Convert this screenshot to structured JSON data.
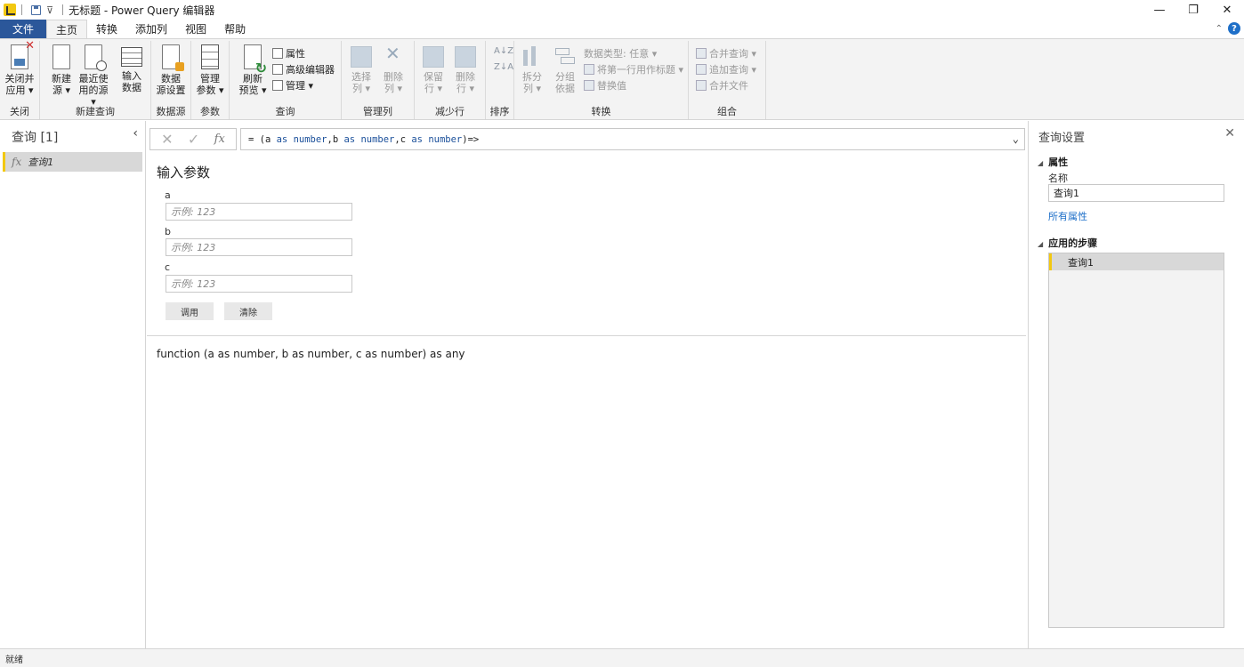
{
  "titlebar": {
    "title": "无标题 - Power Query 编辑器",
    "qa_dropdown": "⊽",
    "window_buttons": {
      "minimize": "—",
      "restore": "❐",
      "close": "✕"
    }
  },
  "menu": {
    "tabs": [
      {
        "label": "文件"
      },
      {
        "label": "主页"
      },
      {
        "label": "转换"
      },
      {
        "label": "添加列"
      },
      {
        "label": "视图"
      },
      {
        "label": "帮助"
      }
    ],
    "collapse": "⌃",
    "help": "?"
  },
  "ribbon": {
    "close": {
      "group_label": "关闭",
      "close_apply": "关闭并\n应用 ▾"
    },
    "new_query": {
      "group_label": "新建查询",
      "new_source": "新建\n源 ▾",
      "recent_sources": "最近使\n用的源 ▾",
      "enter_data": "输入\n数据"
    },
    "data_sources": {
      "group_label": "数据源",
      "settings": "数据\n源设置"
    },
    "parameters": {
      "group_label": "参数",
      "manage": "管理\n参数 ▾"
    },
    "query": {
      "group_label": "查询",
      "refresh_preview": "刷新\n预览 ▾",
      "properties": "属性",
      "advanced_editor": "高级编辑器",
      "manage": "管理 ▾"
    },
    "manage_columns": {
      "group_label": "管理列",
      "choose_columns": "选择\n列 ▾",
      "remove_columns": "删除\n列 ▾"
    },
    "reduce_rows": {
      "group_label": "减少行",
      "keep_rows": "保留\n行 ▾",
      "remove_rows": "删除\n行 ▾"
    },
    "sort": {
      "group_label": "排序",
      "asc": "A↓Z",
      "desc": "Z↓A"
    },
    "transform": {
      "group_label": "转换",
      "split_column": "拆分\n列 ▾",
      "group_by": "分组\n依据",
      "data_type": "数据类型: 任意 ▾",
      "first_row_header": "将第一行用作标题 ▾",
      "replace_values": "替换值"
    },
    "combine": {
      "group_label": "组合",
      "merge_queries": "合并查询 ▾",
      "append_queries": "追加查询 ▾",
      "combine_files": "合并文件"
    }
  },
  "left_pane": {
    "title": "查询 [1]",
    "collapse": "‹",
    "items": [
      {
        "icon_text": "fx",
        "label": "查询1"
      }
    ]
  },
  "formula_bar": {
    "cancel": "✕",
    "confirm": "✓",
    "fx": "fx",
    "tokens": [
      {
        "t": "= (a ",
        "kw": false
      },
      {
        "t": "as number",
        "kw": true
      },
      {
        "t": ",b ",
        "kw": false
      },
      {
        "t": "as number",
        "kw": true
      },
      {
        "t": ",c ",
        "kw": false
      },
      {
        "t": "as number",
        "kw": true
      },
      {
        "t": ")=>",
        "kw": false
      }
    ],
    "expand": "⌄"
  },
  "main": {
    "title": "输入参数",
    "params": [
      {
        "name": "a",
        "placeholder": "示例: 123"
      },
      {
        "name": "b",
        "placeholder": "示例: 123"
      },
      {
        "name": "c",
        "placeholder": "示例: 123"
      }
    ],
    "invoke": "调用",
    "clear": "清除",
    "signature": "function (a as number, b as number, c as number) as any"
  },
  "right_pane": {
    "title": "查询设置",
    "close": "✕",
    "properties_section": "属性",
    "name_label": "名称",
    "name_value": "查询1",
    "all_properties": "所有属性",
    "steps_section": "应用的步骤",
    "steps": [
      {
        "label": "查询1"
      }
    ]
  },
  "statusbar": {
    "text": "就绪"
  }
}
